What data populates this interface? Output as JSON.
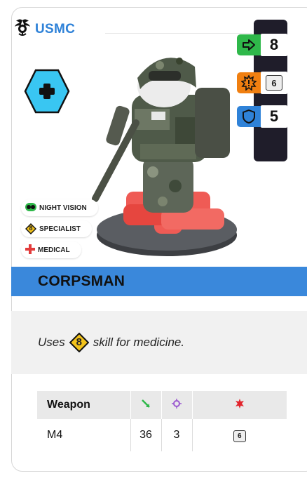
{
  "card": {
    "faction": {
      "name": "USMC",
      "emblem_icon": "eagle-globe-anchor-icon"
    },
    "role_icon": "medic-cross-hexagon-icon",
    "stats": [
      {
        "name": "move",
        "icon": "arrow-right-icon",
        "color": "#2fb84a",
        "value": "8"
      },
      {
        "name": "skill",
        "icon": "explosion-shield-icon",
        "color": "#f07f10",
        "value": "6"
      },
      {
        "name": "save",
        "icon": "shield-icon",
        "color": "#2f82d8",
        "value": "5"
      }
    ],
    "tags": [
      {
        "label": "NIGHT VISION",
        "icon": "binoculars-icon",
        "color": "#2fb84a"
      },
      {
        "label": "SPECIALIST",
        "icon": "diamond-8-icon",
        "badge": "8",
        "color": "#f2c21b"
      },
      {
        "label": "MEDICAL",
        "icon": "medical-cross-icon",
        "color": "#e23b3b"
      }
    ],
    "unit_name": "CORPSMAN",
    "ability": {
      "prefix": "Uses",
      "skill_value": "8",
      "suffix": "skill for medicine."
    },
    "weapons": {
      "headers": [
        {
          "label": "Weapon"
        },
        {
          "icon": "range-icon",
          "color": "#2fb84a"
        },
        {
          "icon": "target-icon",
          "color": "#9b59d0"
        },
        {
          "icon": "damage-burst-icon",
          "color": "#e2242c"
        }
      ],
      "rows": [
        {
          "name": "M4",
          "range": "36",
          "shots": "3",
          "damage": "6"
        }
      ]
    },
    "colors": {
      "accent": "#3a88db",
      "statbar": "#1f1d2a"
    }
  }
}
